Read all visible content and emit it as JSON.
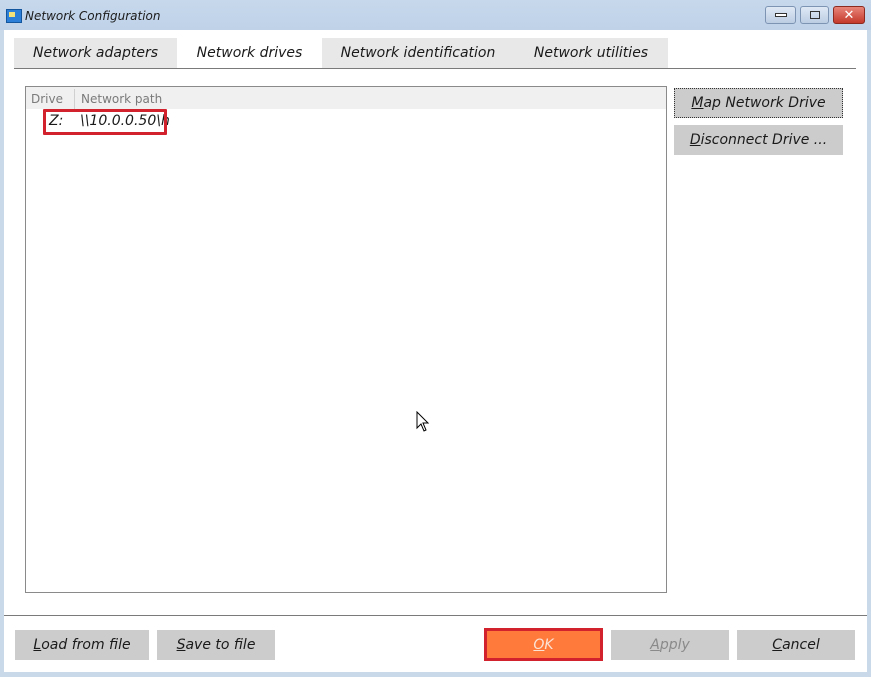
{
  "window": {
    "title": "Network Configuration",
    "controls": {
      "minimize": "minimize",
      "maximize": "maximize",
      "close": "✕"
    }
  },
  "tabs": [
    {
      "label": "Network adapters",
      "active": false
    },
    {
      "label": "Network drives",
      "active": true
    },
    {
      "label": "Network identification",
      "active": false
    },
    {
      "label": "Network utilities",
      "active": false
    }
  ],
  "drive_list": {
    "columns": [
      "Drive",
      "Network path"
    ],
    "rows": [
      {
        "drive": "Z:",
        "path": "\\\\10.0.0.50\\h"
      }
    ]
  },
  "side_buttons": {
    "map": {
      "accel": "M",
      "rest": "ap Network Drive"
    },
    "disconnect": {
      "accel": "D",
      "rest": "isconnect Drive ..."
    }
  },
  "bottom_buttons": {
    "load": {
      "accel": "L",
      "rest": "oad from file"
    },
    "save": {
      "accel": "S",
      "rest": "ave to file"
    },
    "ok": {
      "accel": "O",
      "rest": "K"
    },
    "apply": {
      "accel": "A",
      "rest": "pply",
      "enabled": false
    },
    "cancel": {
      "accel": "C",
      "rest": "ancel"
    }
  },
  "colors": {
    "highlight": "#d2222d",
    "ok_button": "#ff7a3b",
    "button": "#cccccc"
  }
}
